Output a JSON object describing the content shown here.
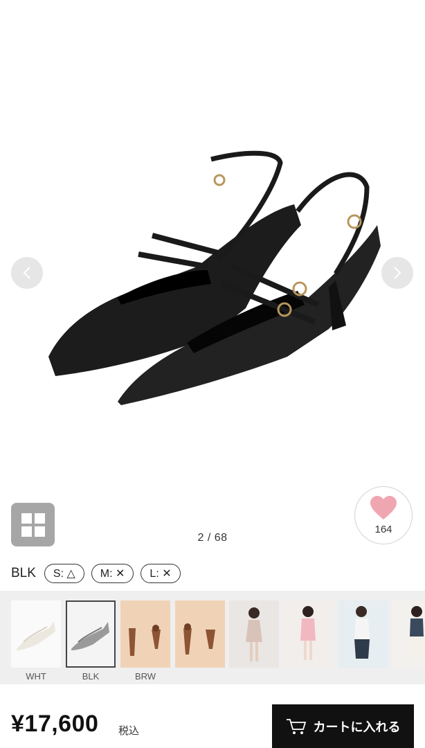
{
  "gallery": {
    "counter": "2 / 68",
    "prev_icon": "chevron-left-icon",
    "next_icon": "chevron-right-icon",
    "grid_icon": "grid-icon"
  },
  "favorite": {
    "icon": "heart-icon",
    "count": "164",
    "color": "#f0a6b1"
  },
  "variant": {
    "color_name": "BLK",
    "sizes": [
      {
        "label": "S: △"
      },
      {
        "label": "M: ✕"
      },
      {
        "label": "L: ✕"
      }
    ]
  },
  "thumbnails": [
    {
      "label": "WHT",
      "selected": false
    },
    {
      "label": "BLK",
      "selected": true
    },
    {
      "label": "BRW",
      "selected": false
    },
    {
      "label": "",
      "selected": false
    },
    {
      "label": "",
      "selected": false
    },
    {
      "label": "",
      "selected": false
    },
    {
      "label": "",
      "selected": false
    },
    {
      "label": "",
      "selected": false
    }
  ],
  "purchase": {
    "price": "¥17,600",
    "tax_note": "税込",
    "cart_label": "カートに入れる",
    "cart_icon": "cart-icon"
  }
}
